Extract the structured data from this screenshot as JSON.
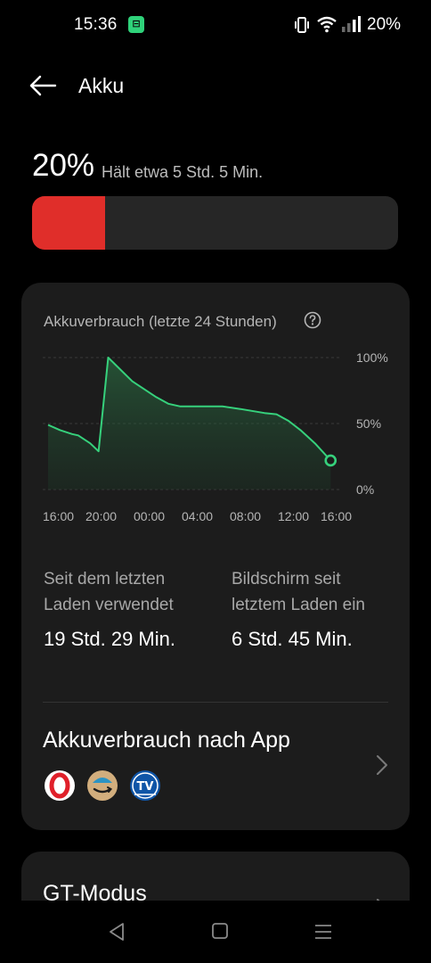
{
  "status_bar": {
    "time": "15:36",
    "notification_icon": "app-notification-icon",
    "battery_text": "20%",
    "icons": [
      "vibrate-icon",
      "wifi-icon",
      "signal-icon"
    ]
  },
  "header": {
    "title": "Akku",
    "back_icon": "back-arrow-icon"
  },
  "battery": {
    "percent": "20%",
    "remaining": "Hält etwa 5 Std. 5 Min.",
    "level": 0.2,
    "fill_color": "#e02e2a"
  },
  "usage_card": {
    "chart_title": "Akkuverbrauch (letzte 24 Stunden)",
    "help_icon": "help-circle-icon"
  },
  "chart_data": {
    "type": "area",
    "x_tick_labels": [
      "16:00",
      "20:00",
      "00:00",
      "04:00",
      "08:00",
      "12:00",
      "16:00"
    ],
    "y_tick_labels": [
      "100%",
      "50%",
      "0%"
    ],
    "ylim": [
      0,
      100
    ],
    "x_hours": [
      0,
      1,
      2,
      2.5,
      3.5,
      4.2,
      5,
      7,
      9,
      10,
      11,
      14.5,
      16,
      18,
      19,
      20,
      21,
      22.2,
      23.5
    ],
    "values": [
      49,
      45,
      42,
      41,
      35,
      29,
      100,
      82,
      70,
      65,
      63,
      63,
      61,
      58,
      57,
      52,
      45,
      35,
      22
    ],
    "color": "#36d17c",
    "grid": true
  },
  "stats": {
    "used_label": "Seit dem letzten Laden verwendet",
    "used_value": "19 Std. 29 Min.",
    "screen_label": "Bildschirm seit letztem Laden ein",
    "screen_value": "6 Std. 45 Min."
  },
  "app_usage": {
    "title": "Akkuverbrauch nach App",
    "apps": [
      "opera-app-icon",
      "amazon-app-icon",
      "tv-app-icon"
    ],
    "chevron": "chevron-right-icon"
  },
  "gt_mode": {
    "title": "GT-Modus"
  },
  "nav_bar": {
    "icons": [
      "back-triangle-icon",
      "home-square-icon",
      "recents-menu-icon"
    ]
  }
}
